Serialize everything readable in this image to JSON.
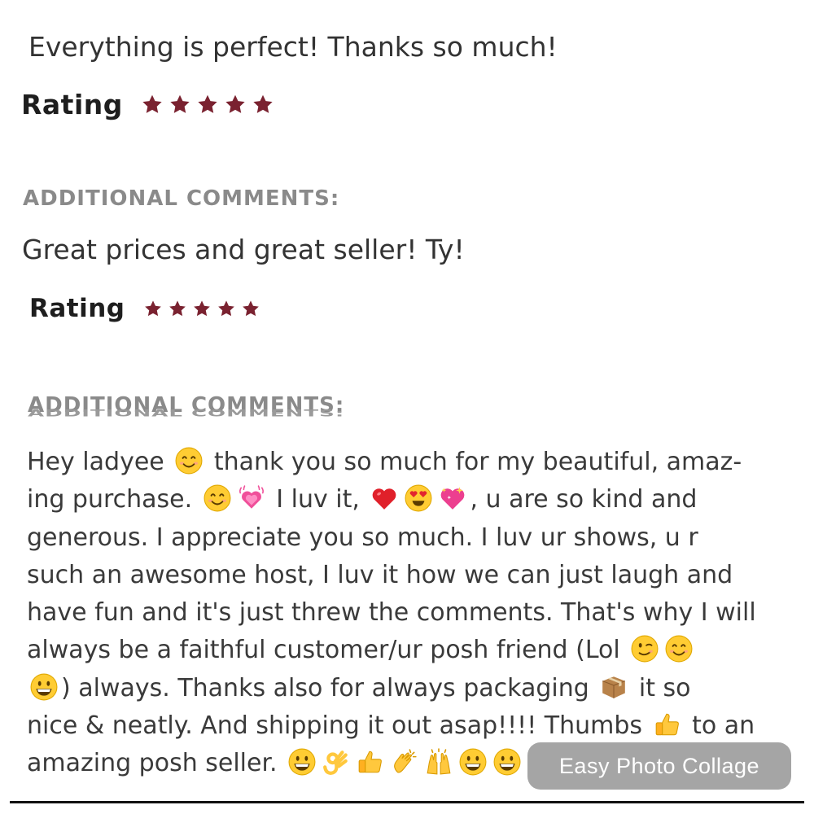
{
  "review1": {
    "comment": "Everything is perfect! Thanks so much!",
    "rating_label": "Rating",
    "stars": 5
  },
  "review2": {
    "heading": "ADDITIONAL COMMENTS:",
    "comment": "Great prices and great seller! Ty!",
    "rating_label": "Rating",
    "stars": 5
  },
  "review3": {
    "heading": "ADDITIONAL COMMENTS:",
    "heading_ghost": "ADDITIONAL COMMENTS:",
    "lines": [
      [
        {
          "t": "Hey ladyee "
        },
        {
          "e": "smiling-face-emoji"
        },
        {
          "t": " thank you so much for my beautiful, amaz-"
        }
      ],
      [
        {
          "t": "ing purchase. "
        },
        {
          "e": "smiling-face-emoji"
        },
        {
          "e": "growing-heart-emoji"
        },
        {
          "t": " I luv it, "
        },
        {
          "e": "red-heart-emoji"
        },
        {
          "e": "heart-eyes-emoji"
        },
        {
          "e": "sparkling-heart-emoji"
        },
        {
          "t": ", u are so kind and"
        }
      ],
      [
        {
          "t": "generous. I appreciate you so much. I luv ur shows, u r"
        }
      ],
      [
        {
          "t": "such an awesome host, I luv it how we can just laugh and"
        }
      ],
      [
        {
          "t": "have fun and it's just threw the comments. That's why I will"
        }
      ],
      [
        {
          "t": "always be a faithful customer/ur posh friend (Lol "
        },
        {
          "e": "winking-face-emoji"
        },
        {
          "e": "smiling-face-emoji"
        }
      ],
      [
        {
          "e": "grinning-face-emoji"
        },
        {
          "t": ") always. Thanks also for always packaging "
        },
        {
          "e": "package-emoji"
        },
        {
          "t": " it so"
        }
      ],
      [
        {
          "t": "nice & neatly. And shipping it out asap!!!! Thumbs "
        },
        {
          "e": "thumbs-up-emoji"
        },
        {
          "t": " to an"
        }
      ],
      [
        {
          "t": "amazing posh seller. "
        },
        {
          "e": "grinning-face-emoji"
        },
        {
          "e": "ok-hand-emoji"
        },
        {
          "e": "thumbs-up-emoji"
        },
        {
          "e": "clapping-hands-emoji"
        },
        {
          "e": "raising-hands-emoji"
        },
        {
          "e": "grinning-face-emoji"
        },
        {
          "e": "grinning-face-emoji"
        }
      ]
    ]
  },
  "badge": {
    "label": "Easy Photo Collage"
  },
  "colors": {
    "star": "#7a2230",
    "heading": "#8a8a8a",
    "text": "#333333",
    "badge_bg": "#8c8c8c"
  }
}
